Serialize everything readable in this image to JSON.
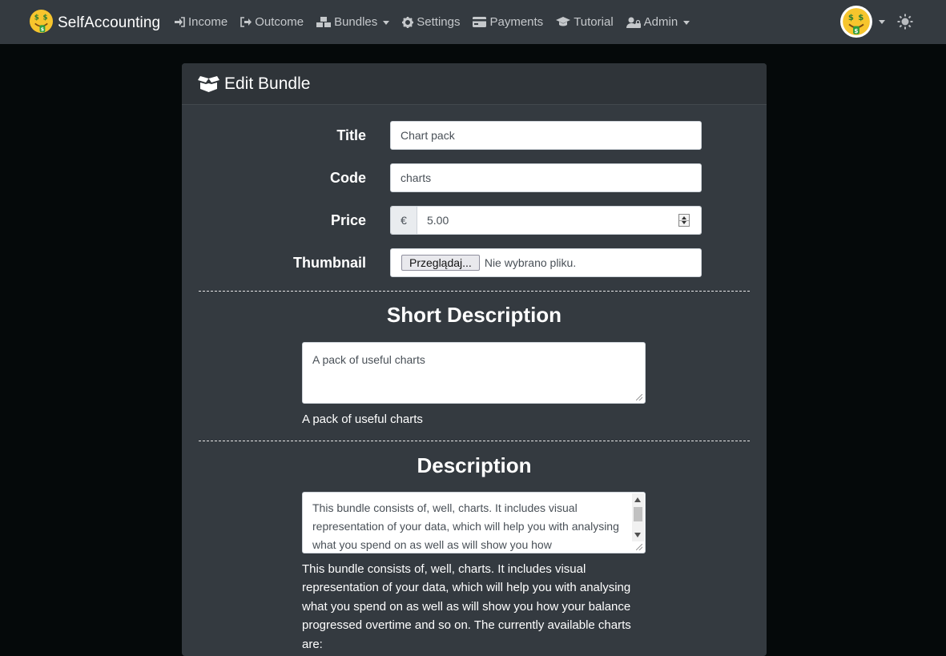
{
  "navbar": {
    "brand": "SelfAccounting",
    "items": [
      {
        "label": "Income",
        "icon": "sign-in-icon"
      },
      {
        "label": "Outcome",
        "icon": "sign-out-icon"
      },
      {
        "label": "Bundles",
        "icon": "cubes-icon"
      },
      {
        "label": "Settings",
        "icon": "gear-icon"
      },
      {
        "label": "Payments",
        "icon": "credit-card-icon"
      },
      {
        "label": "Tutorial",
        "icon": "graduation-cap-icon"
      },
      {
        "label": "Admin",
        "icon": "user-lock-icon"
      }
    ]
  },
  "card": {
    "title": "Edit Bundle",
    "form": {
      "title_label": "Title",
      "title_value": "Chart pack",
      "code_label": "Code",
      "code_value": "charts",
      "price_label": "Price",
      "currency": "€",
      "price_value": "5.00",
      "thumbnail_label": "Thumbnail",
      "file_button": "Przeglądaj...",
      "file_status": "Nie wybrano pliku."
    },
    "short_description": {
      "heading": "Short Description",
      "value": "A pack of useful charts",
      "preview": "A pack of useful charts"
    },
    "description": {
      "heading": "Description",
      "value": "This bundle consists of, well, charts. It includes visual representation of your data, which will help you with analysing what you spend on as well as will show you how",
      "preview": "This bundle consists of, well, charts. It includes visual representation of your data, which will help you with analysing what you spend on as well as will show you how your balance progressed overtime and so on. The currently available charts are:"
    }
  },
  "colors": {
    "navbar_bg": "#343a40",
    "page_bg": "#05090a",
    "card_bg": "#343a40",
    "emoji_yellow": "#f7c52d",
    "emoji_green": "#2e9e3e"
  }
}
